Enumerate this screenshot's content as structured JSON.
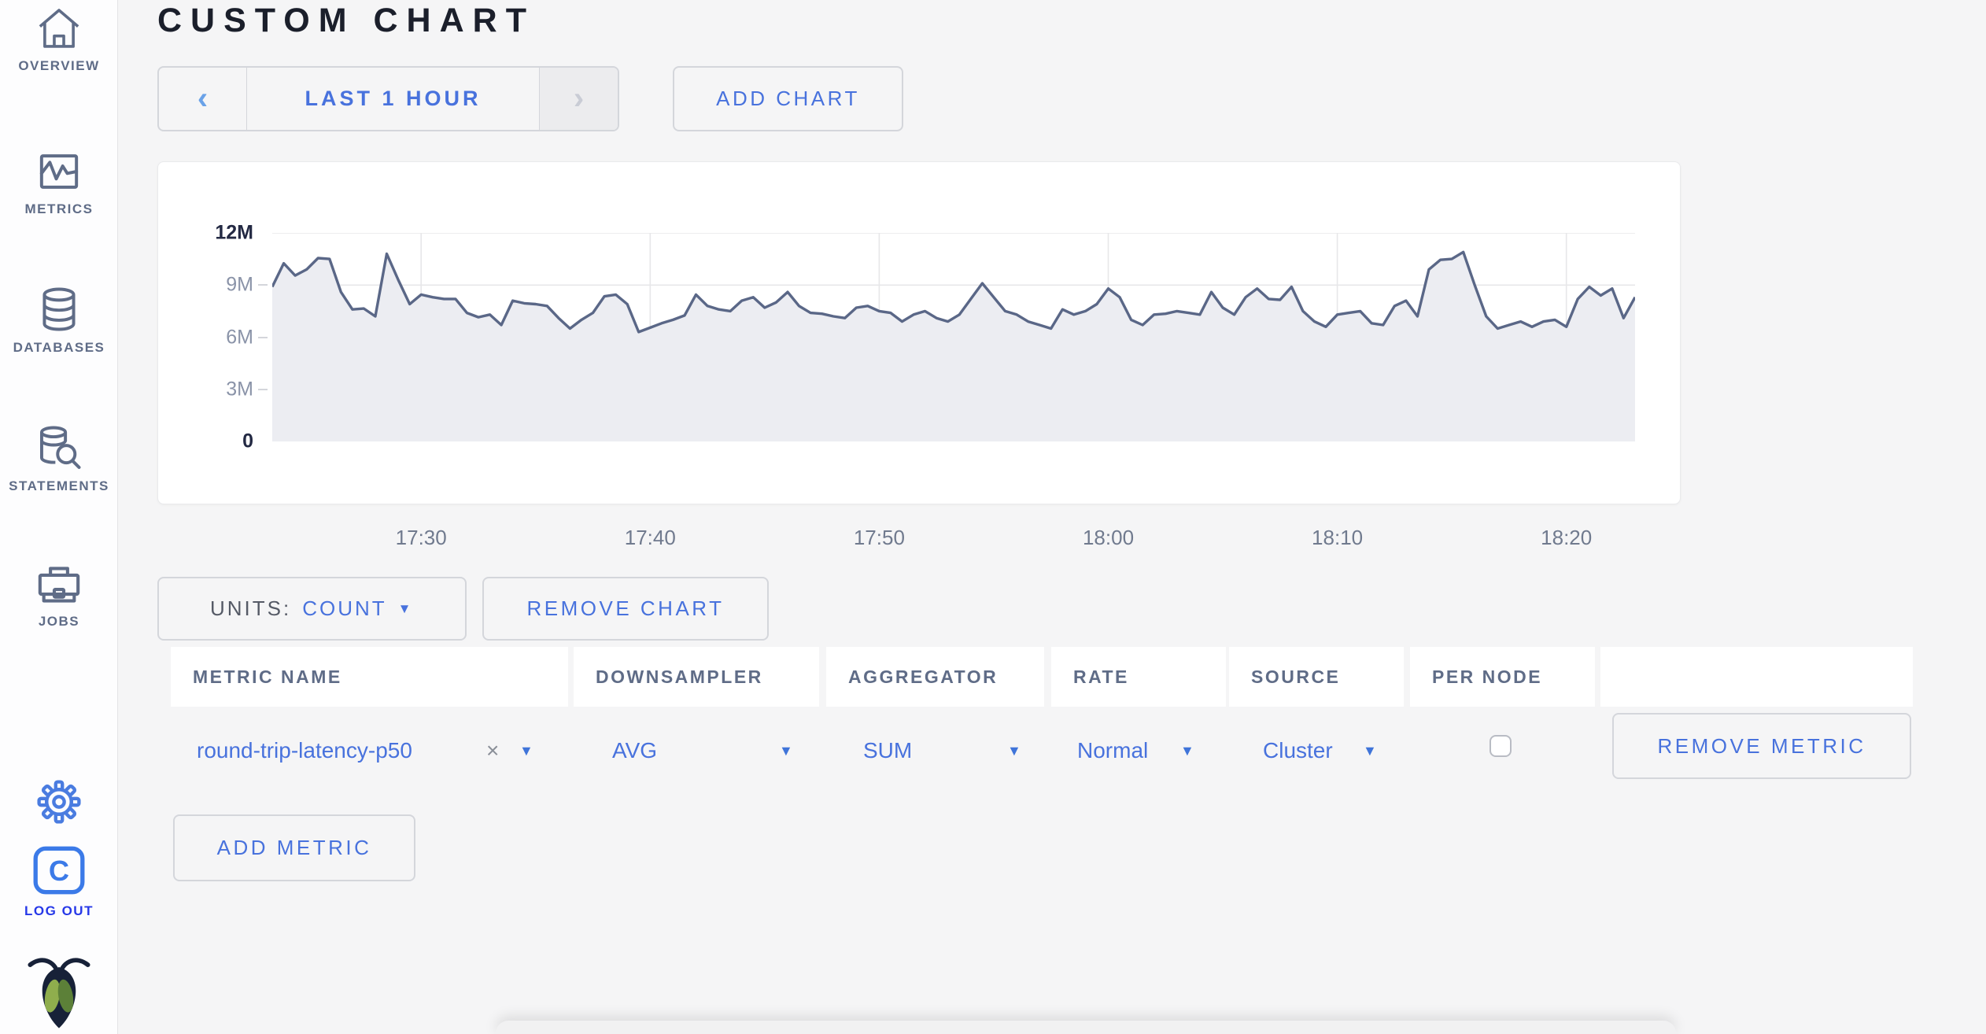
{
  "sidebar": {
    "items": [
      {
        "label": "OVERVIEW",
        "icon": "home-icon"
      },
      {
        "label": "METRICS",
        "icon": "metrics-icon"
      },
      {
        "label": "DATABASES",
        "icon": "database-icon"
      },
      {
        "label": "STATEMENTS",
        "icon": "statements-icon"
      },
      {
        "label": "JOBS",
        "icon": "briefcase-icon"
      }
    ],
    "logout": {
      "letter": "C",
      "label": "LOG OUT"
    }
  },
  "header": {
    "title": "CUSTOM CHART"
  },
  "controls": {
    "prev_glyph": "‹",
    "time_window": "LAST 1 HOUR",
    "next_glyph": "›",
    "add_chart": "ADD CHART"
  },
  "chart_data": {
    "type": "area",
    "title": "",
    "unit": "count (millions)",
    "line_color": "#5a6787",
    "fill_color": "#ecedf2",
    "grid_color": "#e7e7e9",
    "ylim": [
      0,
      12000000
    ],
    "x_start_min": 1043.5,
    "x_end_min": 1103,
    "x_ticks": [
      {
        "min": 1050,
        "label": "17:30"
      },
      {
        "min": 1060,
        "label": "17:40"
      },
      {
        "min": 1070,
        "label": "17:50"
      },
      {
        "min": 1080,
        "label": "18:00"
      },
      {
        "min": 1090,
        "label": "18:10"
      },
      {
        "min": 1100,
        "label": "18:20"
      }
    ],
    "y_ticks": [
      {
        "value": 0,
        "label": "0",
        "dark": true,
        "dash": false
      },
      {
        "value": 3,
        "label": "3M",
        "dark": false,
        "dash": true
      },
      {
        "value": 6,
        "label": "6M",
        "dark": false,
        "dash": true
      },
      {
        "value": 9,
        "label": "9M",
        "dark": false,
        "dash": true
      },
      {
        "value": 12,
        "label": "12M",
        "dark": true,
        "dash": false
      }
    ],
    "series": [
      {
        "name": "round-trip-latency-p50",
        "values_millions": [
          8.9,
          10.25,
          9.55,
          9.9,
          10.55,
          10.5,
          8.6,
          7.6,
          7.65,
          7.2,
          10.8,
          9.3,
          7.9,
          8.45,
          8.3,
          8.2,
          8.2,
          7.4,
          7.15,
          7.3,
          6.7,
          8.1,
          7.95,
          7.9,
          7.8,
          7.1,
          6.5,
          7.0,
          7.4,
          8.35,
          8.45,
          7.9,
          6.3,
          6.55,
          6.8,
          7.0,
          7.25,
          8.45,
          7.8,
          7.6,
          7.5,
          8.1,
          8.3,
          7.7,
          8.0,
          8.6,
          7.8,
          7.4,
          7.35,
          7.2,
          7.1,
          7.7,
          7.8,
          7.5,
          7.4,
          6.9,
          7.3,
          7.5,
          7.1,
          6.9,
          7.3,
          8.2,
          9.1,
          8.3,
          7.5,
          7.3,
          6.9,
          6.7,
          6.5,
          7.6,
          7.3,
          7.5,
          7.9,
          8.8,
          8.3,
          7.0,
          6.7,
          7.3,
          7.35,
          7.5,
          7.4,
          7.3,
          8.6,
          7.7,
          7.3,
          8.3,
          8.8,
          8.2,
          8.15,
          8.9,
          7.5,
          6.9,
          6.6,
          7.3,
          7.4,
          7.5,
          6.8,
          6.7,
          7.8,
          8.1,
          7.2,
          9.9,
          10.45,
          10.5,
          10.9,
          9.0,
          7.2,
          6.5,
          6.7,
          6.9,
          6.6,
          6.9,
          7.0,
          6.6,
          8.2,
          8.9,
          8.4,
          8.8,
          7.1,
          8.3
        ]
      }
    ]
  },
  "chart_controls": {
    "units_label": "UNITS:",
    "units_value": "COUNT",
    "remove_chart": "REMOVE CHART"
  },
  "metrics_table": {
    "columns": [
      "METRIC NAME",
      "DOWNSAMPLER",
      "AGGREGATOR",
      "RATE",
      "SOURCE",
      "PER NODE"
    ],
    "rows": [
      {
        "metric_name": "round-trip-latency-p50",
        "clear_glyph": "×",
        "downsampler": "AVG",
        "aggregator": "SUM",
        "rate": "Normal",
        "source": "Cluster",
        "per_node_checked": false,
        "remove_label": "REMOVE METRIC"
      }
    ],
    "add_metric": "ADD METRIC"
  },
  "glyphs": {
    "caret_down": "▼"
  },
  "colors": {
    "accent_blue": "#4872dd",
    "logout_blue": "#2638e8",
    "slate": "#5f6c87"
  }
}
